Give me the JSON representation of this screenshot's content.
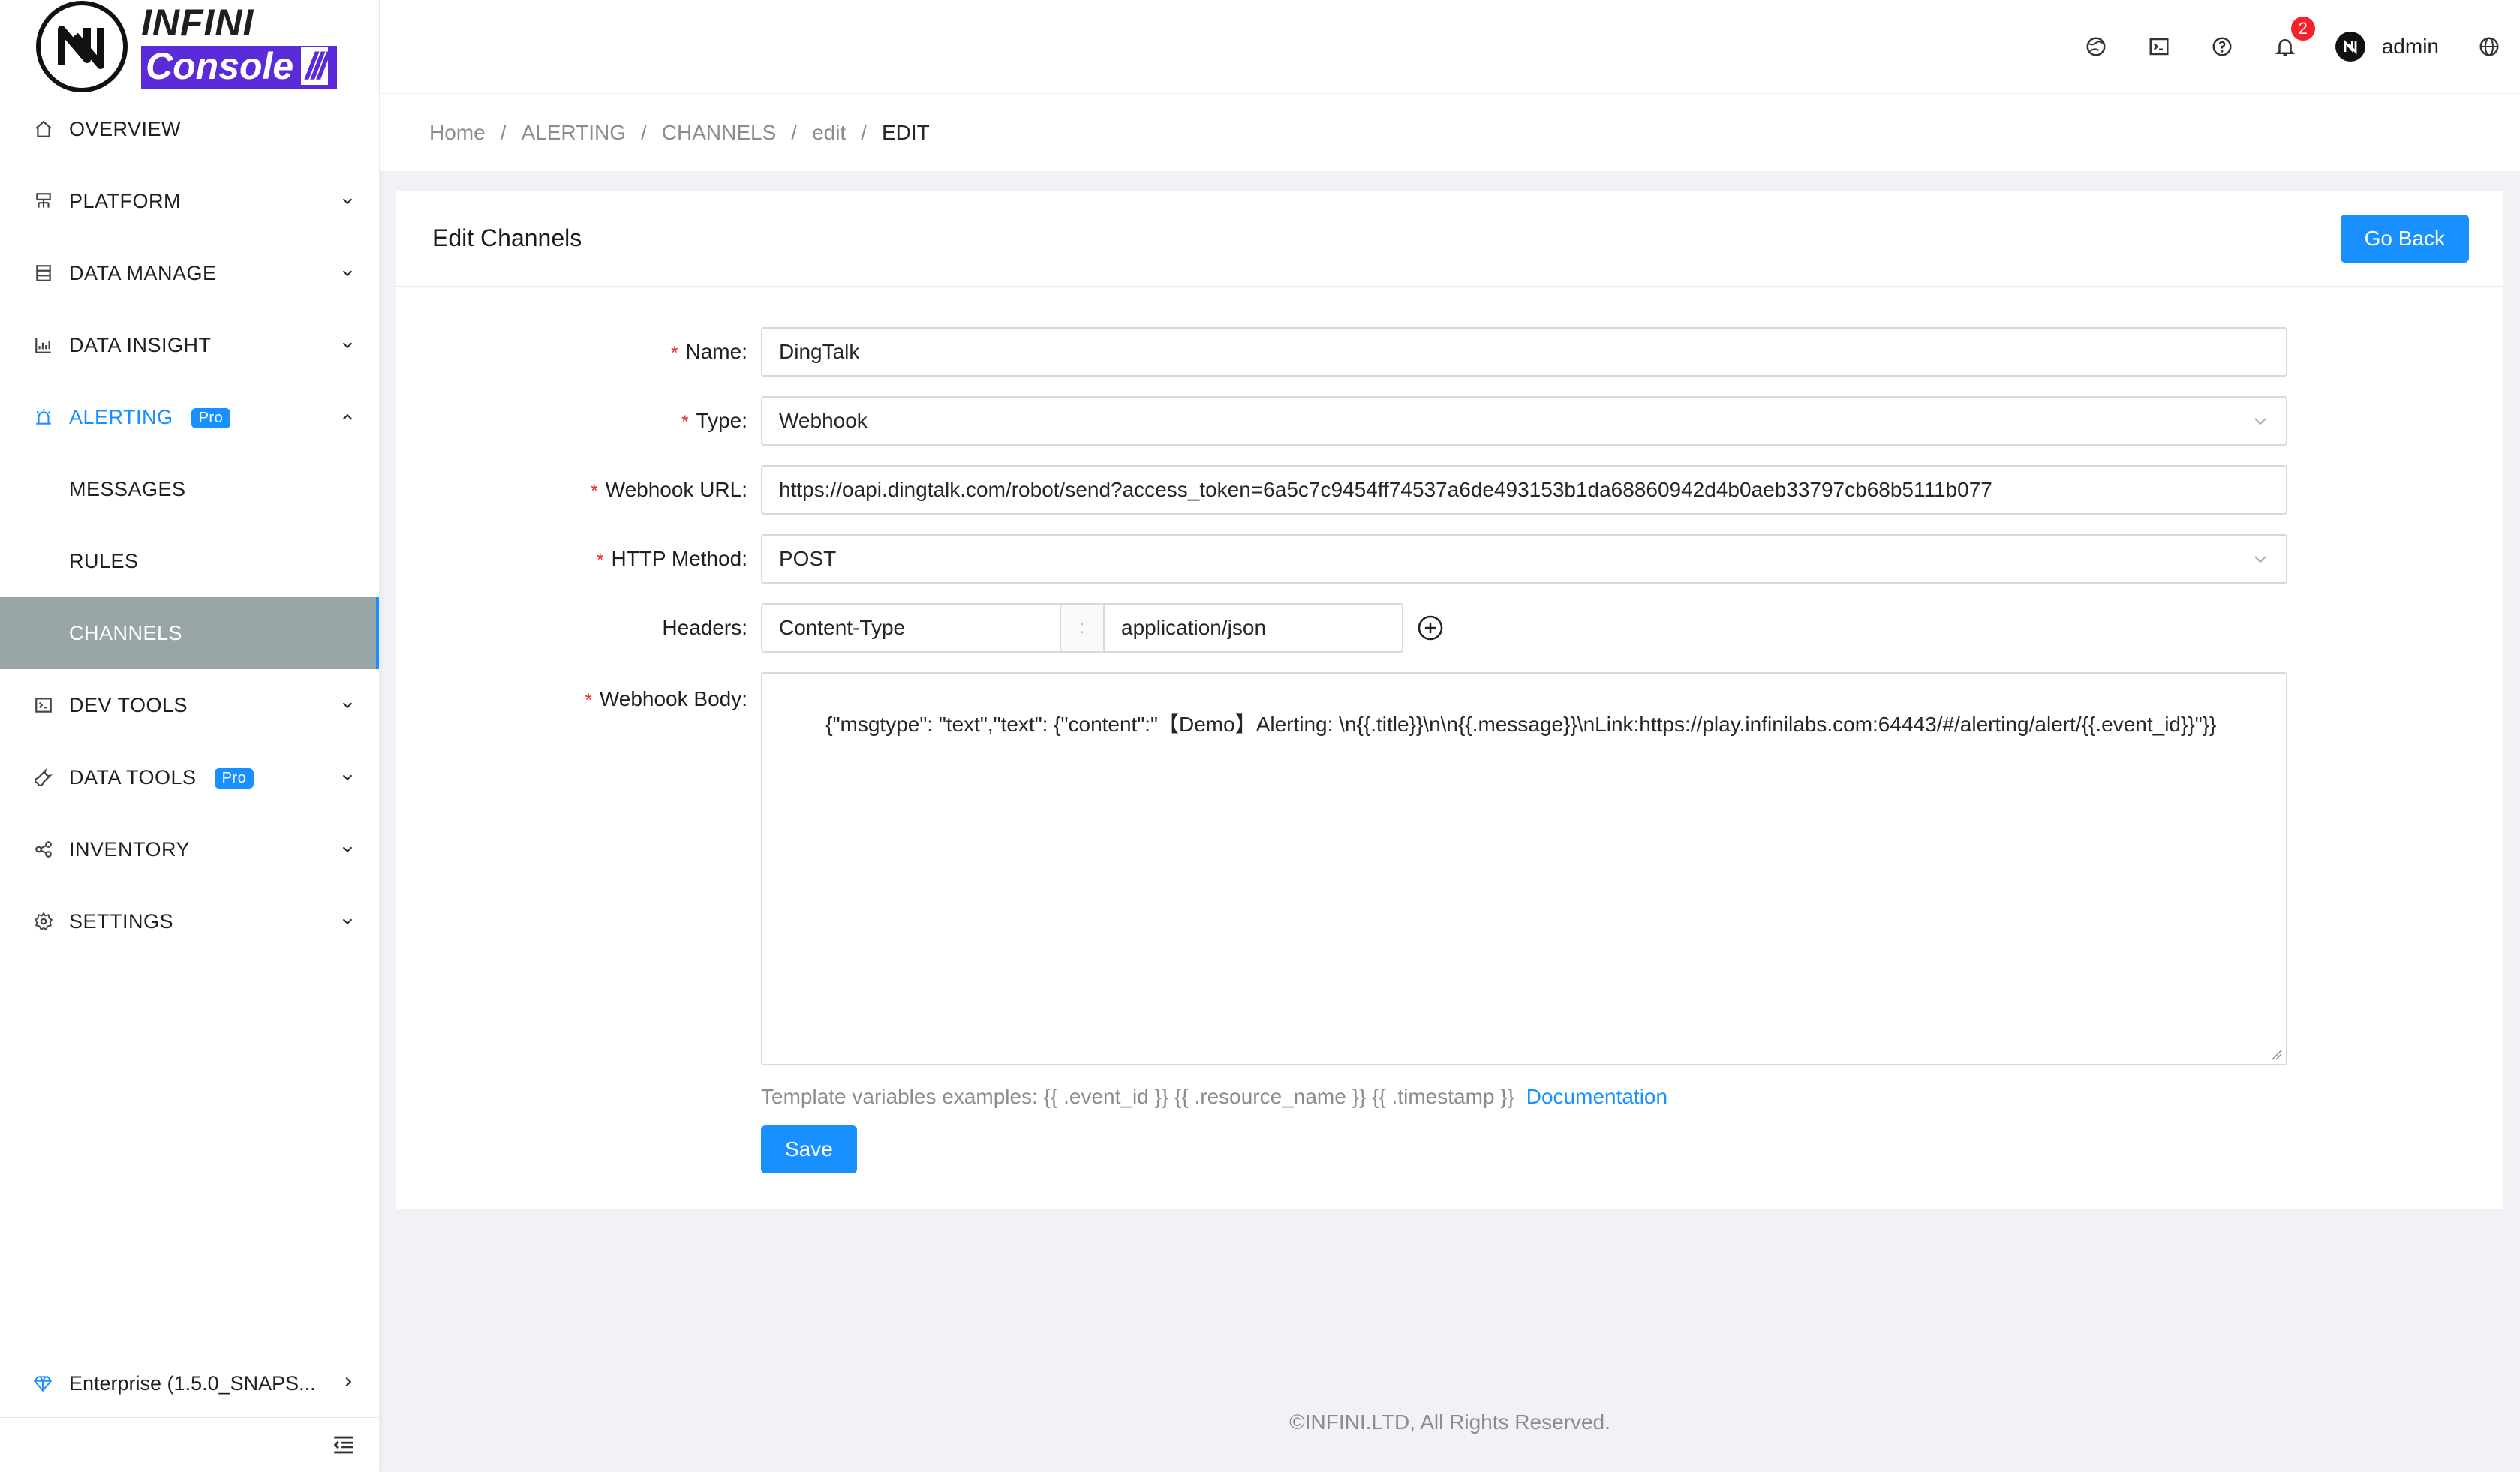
{
  "brand": {
    "line1": "INFINI",
    "line2": "Console",
    "slashes": "///"
  },
  "sidebar": {
    "items": [
      {
        "label": "OVERVIEW",
        "icon": "home-icon"
      },
      {
        "label": "PLATFORM",
        "icon": "platform-icon"
      },
      {
        "label": "DATA MANAGE",
        "icon": "data-manage-icon"
      },
      {
        "label": "DATA INSIGHT",
        "icon": "insight-chart-icon"
      },
      {
        "label": "ALERTING",
        "icon": "alarm-icon",
        "badge": "Pro"
      },
      {
        "label": "MESSAGES"
      },
      {
        "label": "RULES"
      },
      {
        "label": "CHANNELS"
      },
      {
        "label": "DEV TOOLS",
        "icon": "terminal-icon"
      },
      {
        "label": "DATA TOOLS",
        "icon": "tool-icon",
        "badge": "Pro"
      },
      {
        "label": "INVENTORY",
        "icon": "share-nodes-icon"
      },
      {
        "label": "SETTINGS",
        "icon": "gear-icon"
      }
    ],
    "version": "Enterprise (1.5.0_SNAPS..."
  },
  "topbar": {
    "notification_count": "2",
    "username": "admin"
  },
  "breadcrumb": [
    "Home",
    "ALERTING",
    "CHANNELS",
    "edit",
    "EDIT"
  ],
  "card": {
    "title": "Edit Channels",
    "go_back": "Go Back"
  },
  "form": {
    "name_label": "Name",
    "name_value": "DingTalk",
    "type_label": "Type",
    "type_value": "Webhook",
    "url_label": "Webhook URL",
    "url_value": "https://oapi.dingtalk.com/robot/send?access_token=6a5c7c9454ff74537a6de493153b1da68860942d4b0aeb33797cb68b5111b077",
    "method_label": "HTTP Method",
    "method_value": "POST",
    "headers_label": "Headers",
    "header_key": "Content-Type",
    "header_sep": ":",
    "header_value": "application/json",
    "body_label": "Webhook Body",
    "body_value": "{\"msgtype\": \"text\",\"text\": {\"content\":\"【Demo】Alerting: \\n{{.title}}\\n\\n{{.message}}\\nLink:https://play.infinilabs.com:64443/#/alerting/alert/{{.event_id}}\"}}",
    "help_text": "Template variables examples: {{ .event_id }} {{ .resource_name }} {{ .timestamp }}",
    "help_link": "Documentation",
    "save": "Save",
    "colon": ":"
  },
  "footer": "©INFINI.LTD, All Rights Reserved.",
  "colors": {
    "accent": "#1890ff",
    "selected_bg": "#9aa5a7",
    "brand_purple": "#5b2bd9",
    "required": "#f5222d"
  }
}
